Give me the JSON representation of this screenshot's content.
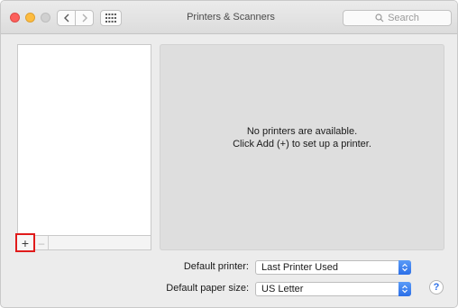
{
  "window": {
    "title": "Printers & Scanners"
  },
  "toolbar": {
    "back_icon": "chevron-left-icon",
    "forward_icon": "chevron-right-icon",
    "show_all_icon": "grid-icon",
    "search_placeholder": "Search"
  },
  "printer_list": {
    "add_label": "+",
    "remove_label": "–"
  },
  "detail": {
    "message_line1": "No printers are available.",
    "message_line2": "Click Add (+) to set up a printer."
  },
  "defaults": {
    "printer_label": "Default printer:",
    "printer_value": "Last Printer Used",
    "paper_label": "Default paper size:",
    "paper_value": "US Letter"
  },
  "help": {
    "label": "?"
  },
  "colors": {
    "highlight": "#e01b1b",
    "accent": "#2c6fe8"
  }
}
